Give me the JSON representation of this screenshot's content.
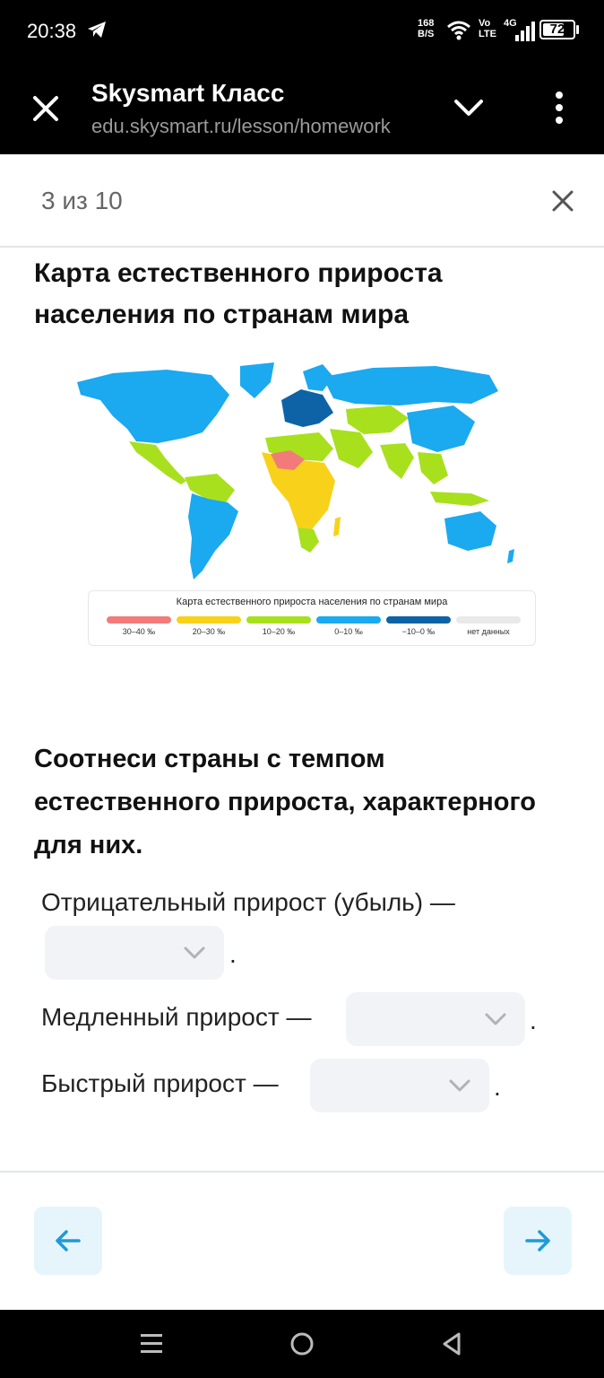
{
  "status_bar": {
    "time": "20:38",
    "net_speed_top": "168",
    "net_speed_bottom": "B/S",
    "volte_top": "Vo",
    "volte_bottom": "LTE",
    "network": "4G",
    "battery": "72",
    "battery_level": 0.72
  },
  "browser": {
    "title": "Skysmart Класс",
    "url": "edu.skysmart.ru/lesson/homework"
  },
  "lesson": {
    "progress": "3 из 10"
  },
  "map": {
    "title": "Карта естественного прироста населения по странам мира",
    "legend_title": "Карта естественного прироста населения по странам мира",
    "legend": [
      {
        "label": "30–40 ‰",
        "color": "#f27a7a"
      },
      {
        "label": "20–30 ‰",
        "color": "#f8d21a"
      },
      {
        "label": "10–20 ‰",
        "color": "#a8e01e"
      },
      {
        "label": "0–10 ‰",
        "color": "#1ba9ef"
      },
      {
        "label": "−10–0 ‰",
        "color": "#0e63a6"
      },
      {
        "label": "нет данных",
        "color": "#e9e9e9"
      }
    ]
  },
  "task": {
    "question": "Соотнеси страны с темпом естественного прироста, характерного для них.",
    "rows": [
      {
        "label": "Отрицательный прирост (убыль) —",
        "value": "",
        "suffix": "."
      },
      {
        "label": "Медленный прирост —",
        "value": "",
        "suffix": "."
      },
      {
        "label": "Быстрый прирост —",
        "value": "",
        "suffix": "."
      }
    ]
  },
  "colors": {
    "accent": "#1f9ad6",
    "nav_button_bg": "#e5f5fb",
    "dropdown_bg": "#f1f3f6"
  }
}
